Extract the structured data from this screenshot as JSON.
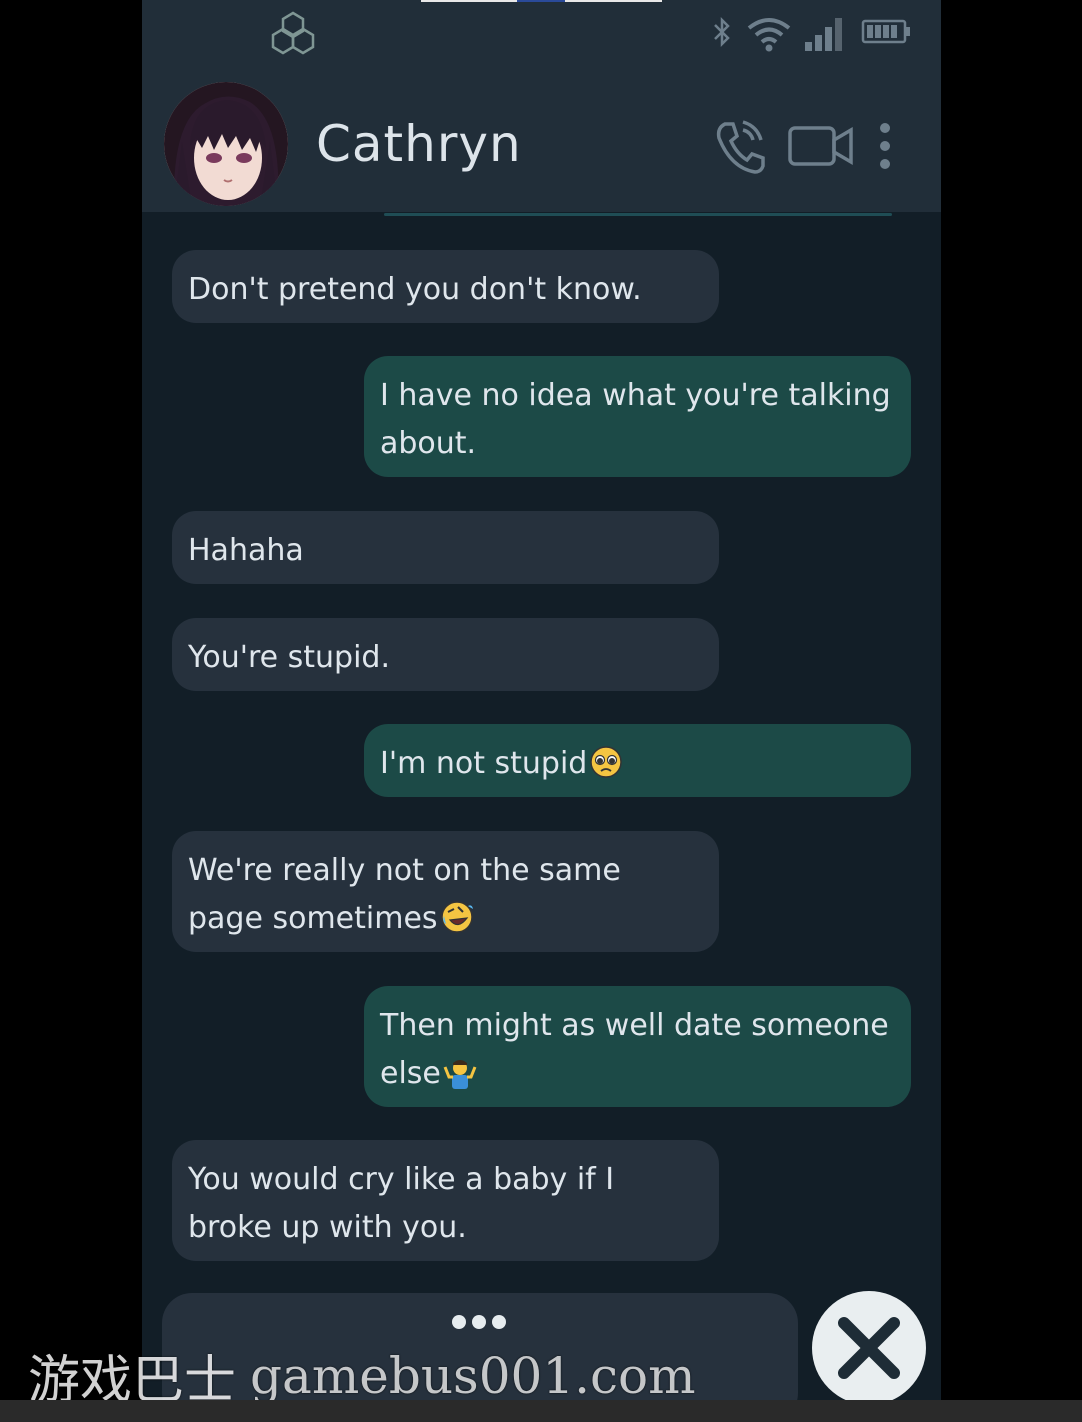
{
  "contact": {
    "name": "Cathryn"
  },
  "header": {
    "call_icon": "phone-icon",
    "video_icon": "video-camera-icon",
    "menu_icon": "more-vertical-icon"
  },
  "status_bar": {
    "icons": [
      "bluetooth-icon",
      "wifi-icon",
      "signal-icon",
      "battery-icon"
    ]
  },
  "messages": [
    {
      "from": "contact",
      "text": "Don't pretend you don't know.",
      "emoji": ""
    },
    {
      "from": "me",
      "text": "I have no idea what you're talking about.",
      "emoji": ""
    },
    {
      "from": "contact",
      "text": "Hahaha",
      "emoji": ""
    },
    {
      "from": "contact",
      "text": "You're stupid.",
      "emoji": ""
    },
    {
      "from": "me",
      "text": "I'm not stupid",
      "emoji": "pleading-face"
    },
    {
      "from": "contact",
      "text": "We're really not on the same page sometimes",
      "emoji": "rolling-on-floor-laughing"
    },
    {
      "from": "me",
      "text": "Then might as well date someone else",
      "emoji": "person-shrugging"
    },
    {
      "from": "contact",
      "text": "You would cry like a baby if I broke up with you.",
      "emoji": ""
    }
  ],
  "composer": {
    "state": "typing",
    "close_icon": "close-icon"
  },
  "watermark": {
    "chinese": "游戏巴士",
    "url": "gamebus001.com"
  },
  "colors": {
    "background": "#121e27",
    "header": "#212e39",
    "received_bubble": "#26313d",
    "sent_bubble": "#1c4a47",
    "text": "#dfe6ec"
  }
}
